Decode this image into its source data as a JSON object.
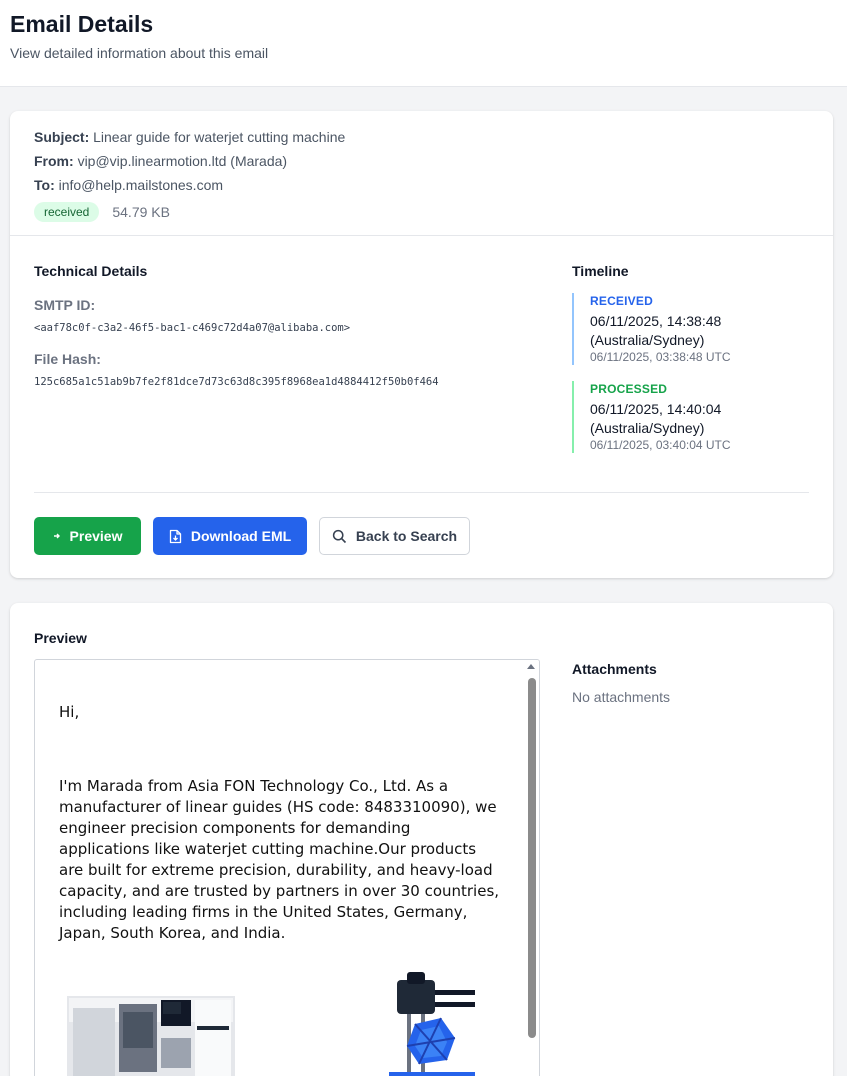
{
  "header": {
    "title": "Email Details",
    "subtitle": "View detailed information about this email"
  },
  "email": {
    "subject_label": "Subject:",
    "subject": "Linear guide for waterjet cutting machine",
    "from_label": "From:",
    "from": "vip@vip.linearmotion.ltd (Marada)",
    "to_label": "To:",
    "to": "info@help.mailstones.com",
    "status": "received",
    "size": "54.79 KB"
  },
  "technical": {
    "title": "Technical Details",
    "smtp_label": "SMTP ID:",
    "smtp_id": "<aaf78c0f-c3a2-46f5-bac1-c469c72d4a07@alibaba.com>",
    "hash_label": "File Hash:",
    "hash": "125c685a1c51ab9b7fe2f81dce7d73c63d8c395f8968ea1d4884412f50b0f464"
  },
  "timeline": {
    "title": "Timeline",
    "items": [
      {
        "status": "RECEIVED",
        "local": "06/11/2025, 14:38:48",
        "tz": "(Australia/Sydney)",
        "utc": "06/11/2025, 03:38:48 UTC"
      },
      {
        "status": "PROCESSED",
        "local": "06/11/2025, 14:40:04",
        "tz": "(Australia/Sydney)",
        "utc": "06/11/2025, 03:40:04 UTC"
      }
    ]
  },
  "actions": {
    "preview": "Preview",
    "download": "Download EML",
    "back": "Back to Search"
  },
  "preview": {
    "title": "Preview",
    "greeting": "Hi,",
    "paragraph": "I'm Marada from Asia FON Technology Co., Ltd. As a manufacturer of linear guides (HS code: 8483310090), we engineer precision components for demanding applications like waterjet cutting machine.Our products are built for extreme precision, durability, and heavy-load capacity, and are trusted by partners in over 30 countries, including leading firms in the United States, Germany, Japan, South Korea, and India."
  },
  "attachments": {
    "title": "Attachments",
    "empty": "No attachments"
  },
  "colors": {
    "green": "#16a34a",
    "blue": "#2563eb",
    "badge_bg": "#dcfce7"
  }
}
